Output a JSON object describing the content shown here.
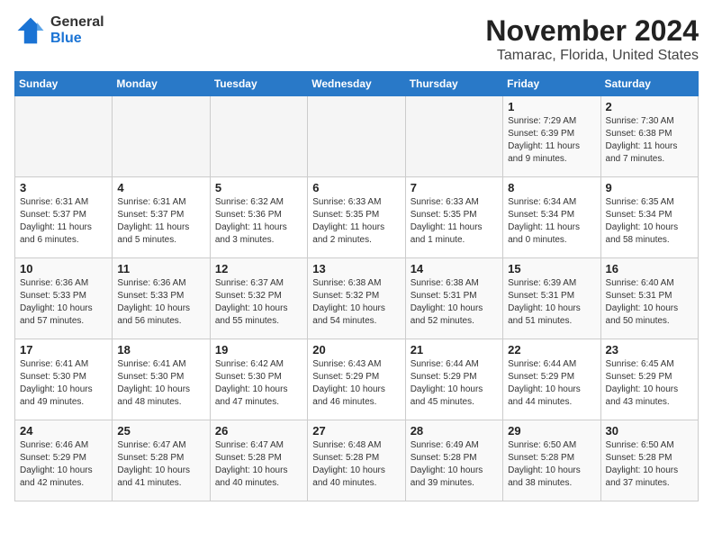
{
  "logo": {
    "general": "General",
    "blue": "Blue"
  },
  "title": "November 2024",
  "subtitle": "Tamarac, Florida, United States",
  "days_of_week": [
    "Sunday",
    "Monday",
    "Tuesday",
    "Wednesday",
    "Thursday",
    "Friday",
    "Saturday"
  ],
  "weeks": [
    [
      {
        "day": "",
        "info": "",
        "empty": true
      },
      {
        "day": "",
        "info": "",
        "empty": true
      },
      {
        "day": "",
        "info": "",
        "empty": true
      },
      {
        "day": "",
        "info": "",
        "empty": true
      },
      {
        "day": "",
        "info": "",
        "empty": true
      },
      {
        "day": "1",
        "info": "Sunrise: 7:29 AM\nSunset: 6:39 PM\nDaylight: 11 hours and 9 minutes."
      },
      {
        "day": "2",
        "info": "Sunrise: 7:30 AM\nSunset: 6:38 PM\nDaylight: 11 hours and 7 minutes."
      }
    ],
    [
      {
        "day": "3",
        "info": "Sunrise: 6:31 AM\nSunset: 5:37 PM\nDaylight: 11 hours and 6 minutes."
      },
      {
        "day": "4",
        "info": "Sunrise: 6:31 AM\nSunset: 5:37 PM\nDaylight: 11 hours and 5 minutes."
      },
      {
        "day": "5",
        "info": "Sunrise: 6:32 AM\nSunset: 5:36 PM\nDaylight: 11 hours and 3 minutes."
      },
      {
        "day": "6",
        "info": "Sunrise: 6:33 AM\nSunset: 5:35 PM\nDaylight: 11 hours and 2 minutes."
      },
      {
        "day": "7",
        "info": "Sunrise: 6:33 AM\nSunset: 5:35 PM\nDaylight: 11 hours and 1 minute."
      },
      {
        "day": "8",
        "info": "Sunrise: 6:34 AM\nSunset: 5:34 PM\nDaylight: 11 hours and 0 minutes."
      },
      {
        "day": "9",
        "info": "Sunrise: 6:35 AM\nSunset: 5:34 PM\nDaylight: 10 hours and 58 minutes."
      }
    ],
    [
      {
        "day": "10",
        "info": "Sunrise: 6:36 AM\nSunset: 5:33 PM\nDaylight: 10 hours and 57 minutes."
      },
      {
        "day": "11",
        "info": "Sunrise: 6:36 AM\nSunset: 5:33 PM\nDaylight: 10 hours and 56 minutes."
      },
      {
        "day": "12",
        "info": "Sunrise: 6:37 AM\nSunset: 5:32 PM\nDaylight: 10 hours and 55 minutes."
      },
      {
        "day": "13",
        "info": "Sunrise: 6:38 AM\nSunset: 5:32 PM\nDaylight: 10 hours and 54 minutes."
      },
      {
        "day": "14",
        "info": "Sunrise: 6:38 AM\nSunset: 5:31 PM\nDaylight: 10 hours and 52 minutes."
      },
      {
        "day": "15",
        "info": "Sunrise: 6:39 AM\nSunset: 5:31 PM\nDaylight: 10 hours and 51 minutes."
      },
      {
        "day": "16",
        "info": "Sunrise: 6:40 AM\nSunset: 5:31 PM\nDaylight: 10 hours and 50 minutes."
      }
    ],
    [
      {
        "day": "17",
        "info": "Sunrise: 6:41 AM\nSunset: 5:30 PM\nDaylight: 10 hours and 49 minutes."
      },
      {
        "day": "18",
        "info": "Sunrise: 6:41 AM\nSunset: 5:30 PM\nDaylight: 10 hours and 48 minutes."
      },
      {
        "day": "19",
        "info": "Sunrise: 6:42 AM\nSunset: 5:30 PM\nDaylight: 10 hours and 47 minutes."
      },
      {
        "day": "20",
        "info": "Sunrise: 6:43 AM\nSunset: 5:29 PM\nDaylight: 10 hours and 46 minutes."
      },
      {
        "day": "21",
        "info": "Sunrise: 6:44 AM\nSunset: 5:29 PM\nDaylight: 10 hours and 45 minutes."
      },
      {
        "day": "22",
        "info": "Sunrise: 6:44 AM\nSunset: 5:29 PM\nDaylight: 10 hours and 44 minutes."
      },
      {
        "day": "23",
        "info": "Sunrise: 6:45 AM\nSunset: 5:29 PM\nDaylight: 10 hours and 43 minutes."
      }
    ],
    [
      {
        "day": "24",
        "info": "Sunrise: 6:46 AM\nSunset: 5:29 PM\nDaylight: 10 hours and 42 minutes."
      },
      {
        "day": "25",
        "info": "Sunrise: 6:47 AM\nSunset: 5:28 PM\nDaylight: 10 hours and 41 minutes."
      },
      {
        "day": "26",
        "info": "Sunrise: 6:47 AM\nSunset: 5:28 PM\nDaylight: 10 hours and 40 minutes."
      },
      {
        "day": "27",
        "info": "Sunrise: 6:48 AM\nSunset: 5:28 PM\nDaylight: 10 hours and 40 minutes."
      },
      {
        "day": "28",
        "info": "Sunrise: 6:49 AM\nSunset: 5:28 PM\nDaylight: 10 hours and 39 minutes."
      },
      {
        "day": "29",
        "info": "Sunrise: 6:50 AM\nSunset: 5:28 PM\nDaylight: 10 hours and 38 minutes."
      },
      {
        "day": "30",
        "info": "Sunrise: 6:50 AM\nSunset: 5:28 PM\nDaylight: 10 hours and 37 minutes."
      }
    ]
  ]
}
